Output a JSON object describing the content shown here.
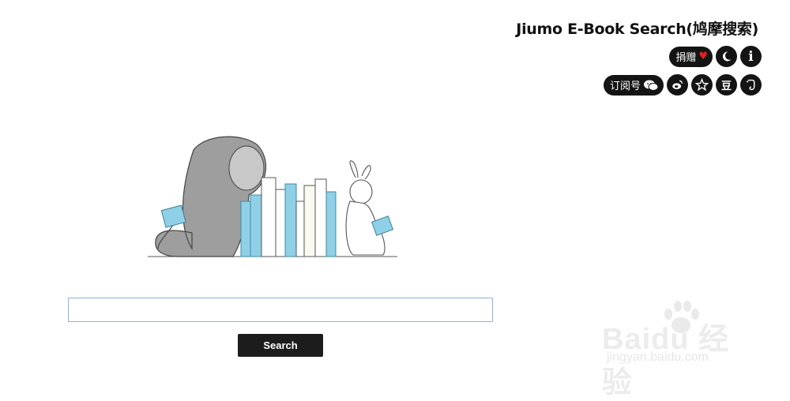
{
  "header": {
    "title": "Jiumo E-Book Search(鸠摩搜索)",
    "donate_label": "捐赠",
    "donate_icon": "heart-icon",
    "subscribe_label": "订阅号",
    "subscribe_icon": "wechat-icon",
    "theme_icon": "moon-icon",
    "info_icon": "info-icon",
    "info_glyph": "i",
    "social_icons": [
      "weibo-icon",
      "star-icon",
      "douban-icon",
      "evernote-icon"
    ],
    "douban_glyph": "豆"
  },
  "illustration": {
    "name": "elephant-and-rabbit-reading-books"
  },
  "search": {
    "value": "",
    "placeholder": "",
    "button_label": "Search"
  },
  "watermark": {
    "main": "Baidu 经验",
    "sub": "jingyan.baidu.com"
  },
  "colors": {
    "accent_dark": "#141414",
    "input_border": "#8ab1e6",
    "heart": "#e02020",
    "book_blue": "#8fd0e6"
  }
}
